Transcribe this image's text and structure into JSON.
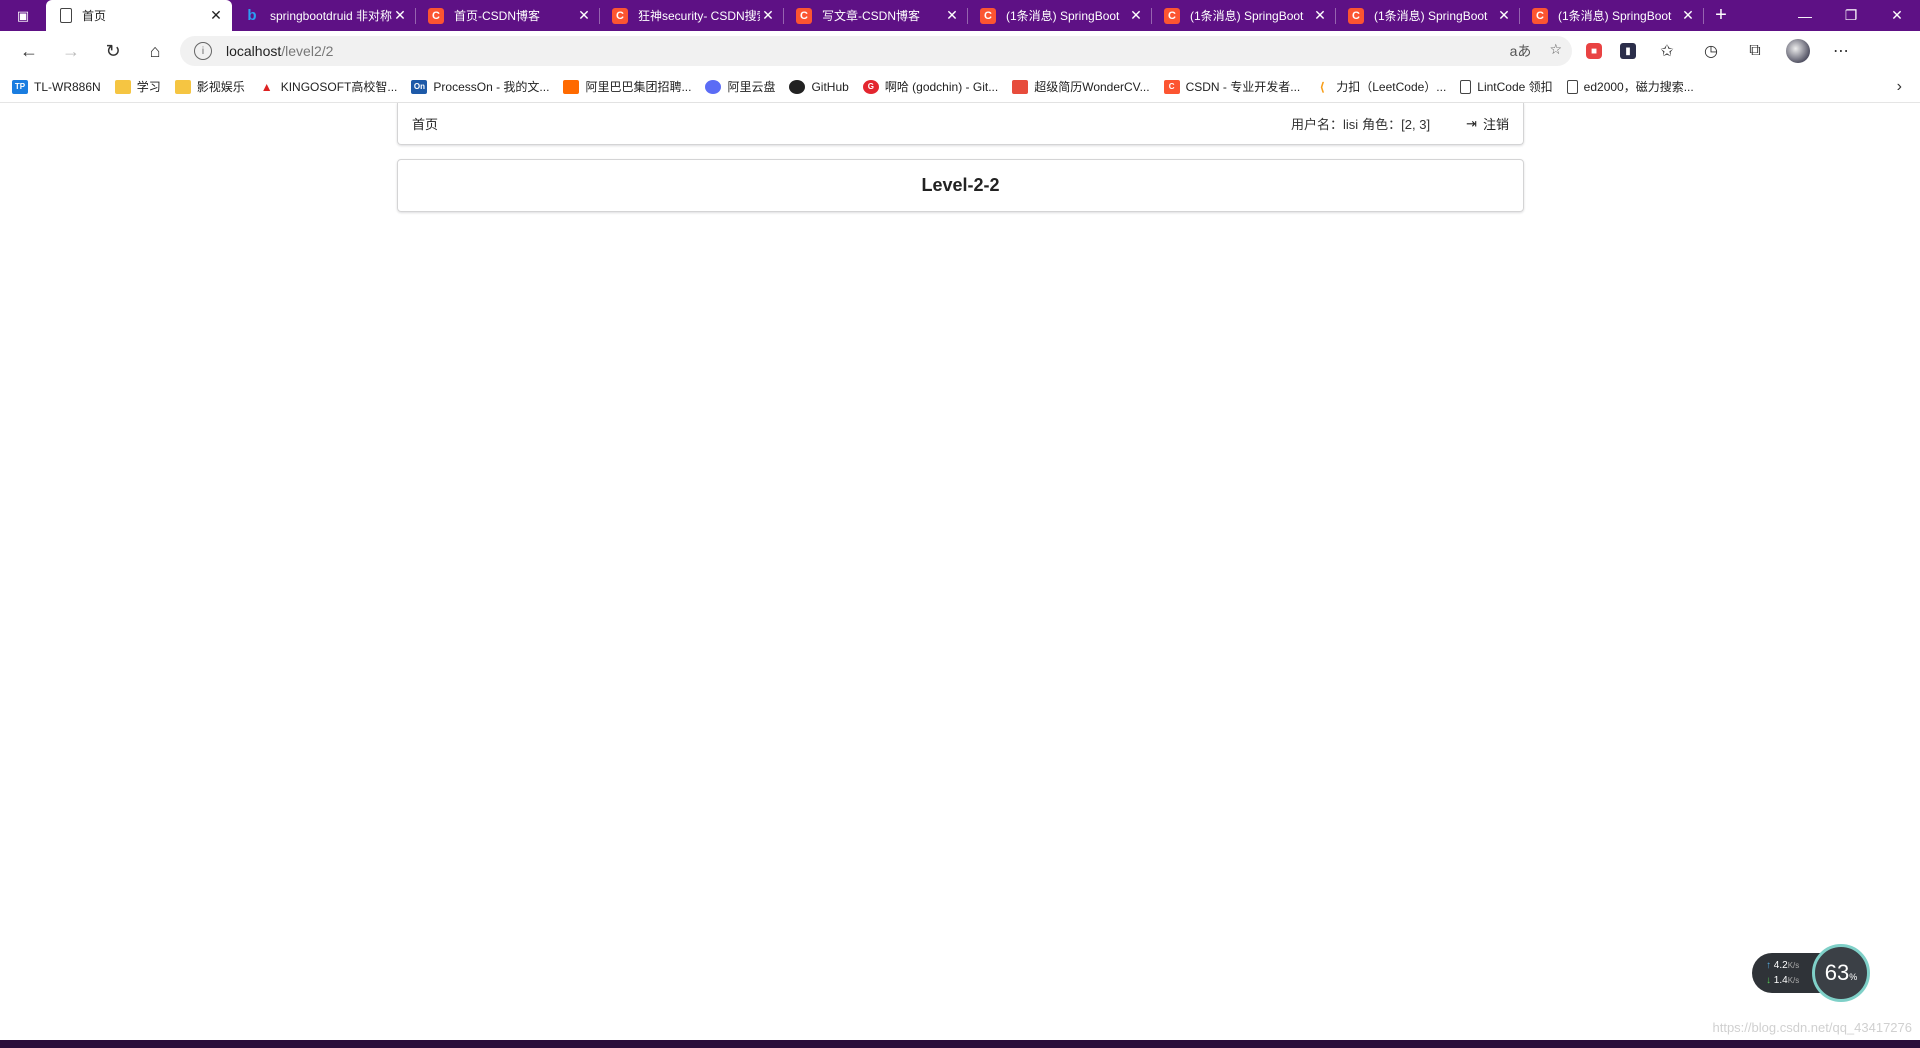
{
  "tabs": [
    {
      "title": "首页",
      "icon": "page-icon",
      "active": true
    },
    {
      "title": "springbootdruid 非对称",
      "icon": "bing-icon"
    },
    {
      "title": "首页-CSDN博客",
      "icon": "csdn-icon"
    },
    {
      "title": "狂神security- CSDN搜索",
      "icon": "csdn-icon"
    },
    {
      "title": "写文章-CSDN博客",
      "icon": "csdn-icon"
    },
    {
      "title": "(1条消息) SpringBoot",
      "icon": "csdn-icon"
    },
    {
      "title": "(1条消息) SpringBoot",
      "icon": "csdn-icon"
    },
    {
      "title": "(1条消息) SpringBoot",
      "icon": "csdn-icon"
    },
    {
      "title": "(1条消息) SpringBoot",
      "icon": "csdn-icon"
    }
  ],
  "address": {
    "host": "localhost",
    "path": "/level2/2"
  },
  "bookmarks": [
    {
      "label": "TL-WR886N",
      "icon": "tp",
      "icon_text": "TP"
    },
    {
      "label": "学习",
      "icon": "folder",
      "icon_text": ""
    },
    {
      "label": "影视娱乐",
      "icon": "folder",
      "icon_text": ""
    },
    {
      "label": "KINGOSOFT高校智...",
      "icon": "king",
      "icon_text": "▲"
    },
    {
      "label": "ProcessOn - 我的文...",
      "icon": "on",
      "icon_text": "On"
    },
    {
      "label": "阿里巴巴集团招聘...",
      "icon": "ali",
      "icon_text": ""
    },
    {
      "label": "阿里云盘",
      "icon": "aliyun",
      "icon_text": ""
    },
    {
      "label": "GitHub",
      "icon": "gh",
      "icon_text": ""
    },
    {
      "label": "啊哈 (godchin) - Git...",
      "icon": "god",
      "icon_text": "G"
    },
    {
      "label": "超级简历WonderCV...",
      "icon": "cv",
      "icon_text": ""
    },
    {
      "label": "CSDN - 专业开发者...",
      "icon": "csdn",
      "icon_text": "C"
    },
    {
      "label": "力扣（LeetCode）...",
      "icon": "leet",
      "icon_text": "⟨"
    },
    {
      "label": "LintCode 领扣",
      "icon": "page",
      "icon_text": ""
    },
    {
      "label": "ed2000，磁力搜索...",
      "icon": "page",
      "icon_text": ""
    }
  ],
  "page": {
    "home_link": "首页",
    "username_label": "用户名：lisi",
    "roles_label": "角色：[2, 3]",
    "logout_label": "注销",
    "heading": "Level-2-2"
  },
  "net_widget": {
    "up": "4.2",
    "down": "1.4",
    "unit": "K/s",
    "percent": "63",
    "percent_unit": "%"
  },
  "watermark": "https://blog.csdn.net/qq_43417276"
}
